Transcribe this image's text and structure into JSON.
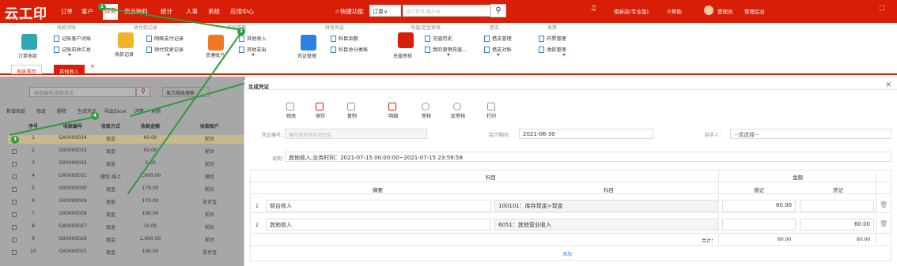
{
  "brand": {
    "logo": "云工印",
    "sub": "YUNGOYIN"
  },
  "nav": [
    "订单",
    "客户",
    "财务",
    "商品物料",
    "统计",
    "人事",
    "系统",
    "应用中心"
  ],
  "quick": "☆快捷功能",
  "search": {
    "select": "订单∨",
    "placeholder": "选订单号/客户名"
  },
  "user": {
    "store": "南新店(专业版)",
    "help": "②帮助",
    "role": "管理员",
    "backend": "管理后台"
  },
  "ribbon": {
    "groups": [
      "收款对账",
      "收付款记录",
      "资金管理",
      "财务凭证",
      "充值/定金审核",
      "借支",
      "发票"
    ],
    "big": [
      "订单收款",
      "收款记录",
      "资金账户",
      "凭证管理",
      "充值审核"
    ],
    "items": [
      "记账客户对账",
      "记账应收汇总",
      "网络支付记录",
      "预付变更记录",
      "其他收入",
      "其他支出",
      "科目余额",
      "科目总分类账",
      "充值历史",
      "我的营销充值...",
      "借支管理",
      "借支对账",
      "开票管理",
      "收款管理"
    ]
  },
  "tabs": [
    "系统首页",
    "其他收入"
  ],
  "bg": {
    "search_placeholder": "收款编号/收款单位",
    "adv": "显示高级搜索",
    "toolbar": [
      "新增收款",
      "修改",
      "删除",
      "生成凭证",
      "导出Excel",
      "详情",
      "刷新"
    ],
    "head": [
      "序号",
      "收款编号",
      "收款方式",
      "收款金额",
      "收款账户"
    ],
    "rows": [
      [
        "1",
        "GX0000034",
        "现金",
        "60.00",
        "前台"
      ],
      [
        "2",
        "GX0000033",
        "现金",
        "50.00",
        "前台"
      ],
      [
        "3",
        "GX0000032",
        "现金",
        "5.00",
        "前台"
      ],
      [
        "4",
        "GX0000031",
        "微信-线上",
        "2,000.00",
        "微信"
      ],
      [
        "5",
        "GX0000030",
        "现金",
        "179.00",
        "前台"
      ],
      [
        "6",
        "GX0000029",
        "现金",
        "170.00",
        "支付宝"
      ],
      [
        "7",
        "GX0000028",
        "现金",
        "100.00",
        "前台"
      ],
      [
        "8",
        "GX0000027",
        "现金",
        "10.00",
        "前台"
      ],
      [
        "9",
        "GX0000026",
        "现金",
        "1,000.00",
        "前台"
      ],
      [
        "10",
        "GX0000025",
        "现金",
        "100.00",
        "支付宝"
      ]
    ]
  },
  "modal": {
    "title": "生成凭证",
    "close": "×",
    "toolbar": [
      "修改",
      "保存",
      "复制",
      "明细",
      "审核",
      "反审核",
      "打印"
    ],
    "voucher_label": "凭证编号：",
    "voucher_placeholder": "编号由系统自动生成",
    "period_label": "会计期间：",
    "period": "2021-06-30",
    "handler_label": "经手人：",
    "handler": "--请选择--",
    "note_label": "说明：",
    "note": "其他收入,业务时间：2021-07-15 00:00:00~2021-07-15 23:59:59",
    "head": {
      "subject": "科目",
      "amount": "金额",
      "summary": "摘要",
      "subject2": "科目",
      "debit": "借记",
      "credit": "贷记"
    },
    "rows": [
      {
        "n": "1",
        "summary": "前台收入",
        "subject": "100101：库存现金>现金",
        "debit": "60.00",
        "credit": ""
      },
      {
        "n": "2",
        "summary": "其他收入",
        "subject": "6051：其他营业收入",
        "debit": "",
        "credit": "60.00"
      }
    ],
    "total_label": "合计：",
    "total_debit": "60.00",
    "total_credit": "60.00",
    "add": "添加"
  },
  "badges": [
    "1",
    "2",
    "3",
    "4"
  ]
}
